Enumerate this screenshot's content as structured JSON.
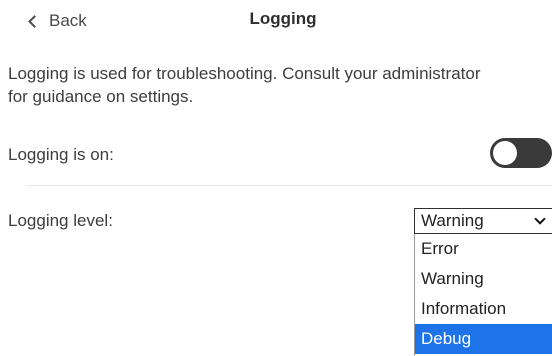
{
  "header": {
    "back_label": "Back",
    "title": "Logging"
  },
  "description": "Logging is used for troubleshooting. Consult your administrator for guidance on settings.",
  "logging_toggle": {
    "label": "Logging is on:",
    "state": "off"
  },
  "logging_level": {
    "label": "Logging level:",
    "selected_value": "Warning",
    "options": [
      {
        "label": "Error"
      },
      {
        "label": "Warning"
      },
      {
        "label": "Information"
      },
      {
        "label": "Debug",
        "highlighted": true
      }
    ]
  },
  "colors": {
    "toggle_track": "#3a3a3a",
    "highlight": "#1e73e8"
  }
}
